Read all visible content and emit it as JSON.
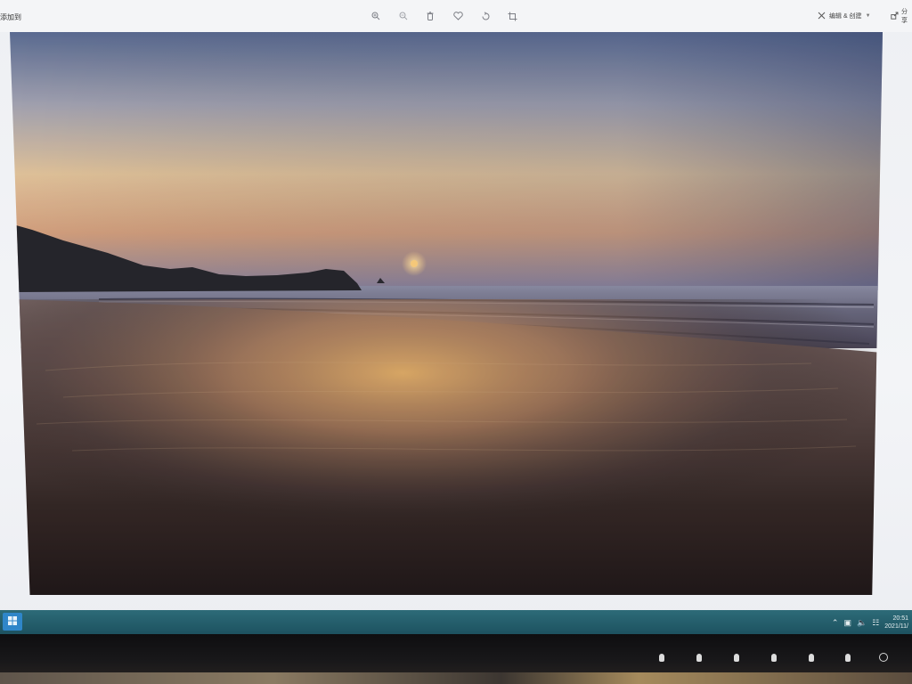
{
  "viewer": {
    "breadcrumb": "添加到",
    "toolbar_icons": [
      "zoom-in-icon",
      "zoom-out-icon",
      "delete-icon",
      "favorite-icon",
      "rotate-icon",
      "crop-icon"
    ],
    "edit_label": "编辑 & 创建",
    "share_label": "分享"
  },
  "photo": {
    "subject": "sunset beach"
  },
  "taskbar": {
    "time": "20:51",
    "date": "2021/11/"
  },
  "colors": {
    "taskbar": "#1d5260",
    "start": "#2f86c9",
    "screen_bg": "#f3f4f7"
  }
}
